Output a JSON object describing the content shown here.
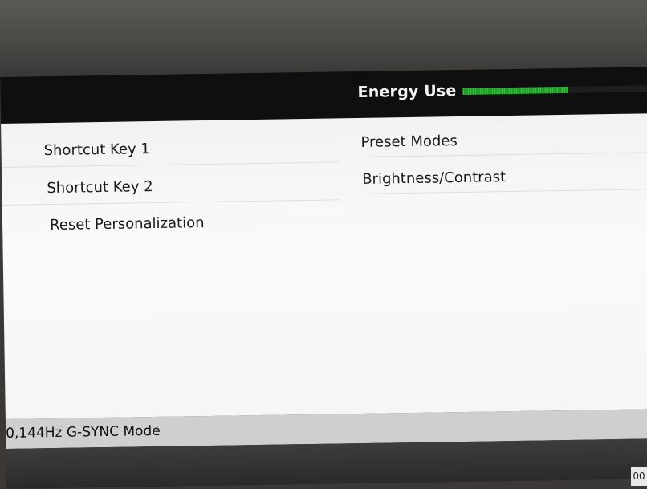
{
  "header": {
    "energy_label": "Energy Use",
    "energy_level": 0.57,
    "energy_color": "#2fbf3a"
  },
  "menu": {
    "left_items": [
      "Shortcut Key 1",
      "Shortcut Key 2",
      "Reset Personalization"
    ],
    "right_items": [
      "Preset Modes",
      "Brightness/Contrast"
    ]
  },
  "status": {
    "text": "0,144Hz  G-SYNC Mode"
  },
  "bottom": {
    "icon_text": "00"
  }
}
